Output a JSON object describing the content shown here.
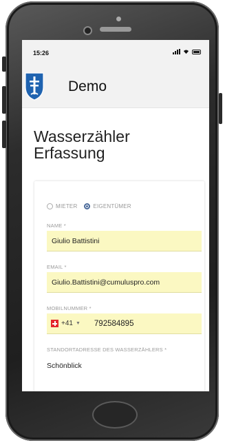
{
  "status_bar": {
    "time": "15:26"
  },
  "app_bar": {
    "title": "Demo"
  },
  "page": {
    "title_line1": "Wasserzähler",
    "title_line2": "Erfassung"
  },
  "form": {
    "radio_options": [
      {
        "label": "MIETER",
        "checked": false
      },
      {
        "label": "EIGENTÜMER",
        "checked": true
      }
    ],
    "name": {
      "label": "NAME *",
      "value": "Giulio Battistini"
    },
    "email": {
      "label": "EMAIL *",
      "value": "Giulio.Battistini@cumuluspro.com"
    },
    "mobile": {
      "label": "MOBILNUMMER *",
      "country_code": "+41",
      "value": "792584895",
      "country_flag": "swiss-flag-icon"
    },
    "address": {
      "label": "STANDORTADRESSE DES WASSERZÄHLERS *",
      "value": "Schönblick"
    }
  },
  "colors": {
    "field_bg": "#fbf8c2",
    "radio_accent": "#4a6a9a",
    "logo_blue": "#1f63b0"
  }
}
